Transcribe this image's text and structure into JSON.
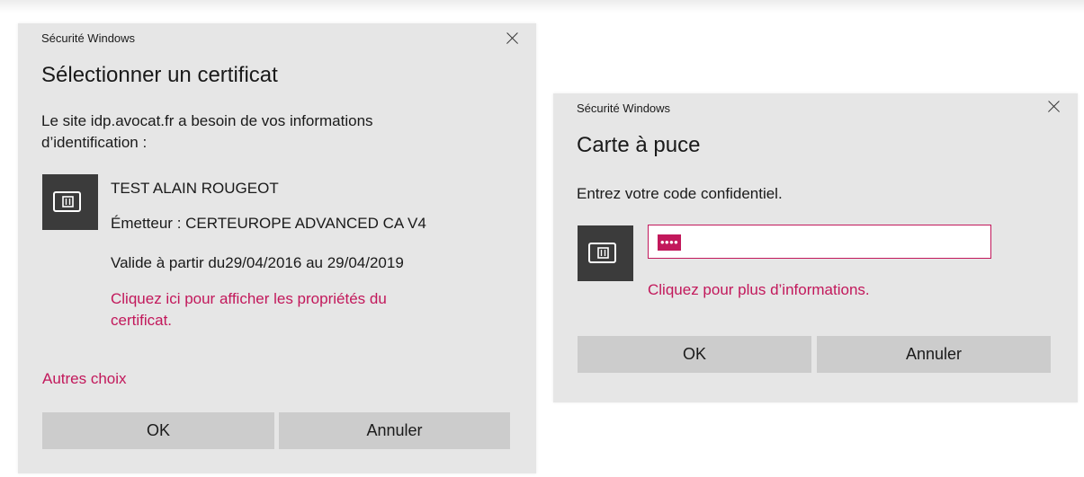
{
  "cert_dialog": {
    "caption": "Sécurité Windows",
    "title": "Sélectionner un certificat",
    "description_line1": "Le site idp.avocat.fr a besoin de vos informations",
    "description_line2": "d’identification :",
    "certificate": {
      "name": "TEST ALAIN ROUGEOT",
      "issuer": "Émetteur : CERTEUROPE ADVANCED CA V4",
      "validity": "Valide à partir du29/04/2016 au 29/04/2019",
      "properties_link_line1": "Cliquez ici pour afficher les propriétés du",
      "properties_link_line2": "certificat."
    },
    "more_choices": "Autres choix",
    "ok_label": "OK",
    "cancel_label": "Annuler"
  },
  "pin_dialog": {
    "caption": "Sécurité Windows",
    "title": "Carte à puce",
    "prompt": "Entrez votre code confidentiel.",
    "pin_value": "••••",
    "info_link": "Cliquez pour plus d’informations.",
    "ok_label": "OK",
    "cancel_label": "Annuler"
  },
  "colors": {
    "dialog_bg": "#e6e6e6",
    "button_bg": "#cccccc",
    "accent_link": "#c2185b",
    "icon_bg": "#3b3b3b"
  },
  "icons": [
    "close-icon",
    "smart-card-icon"
  ]
}
